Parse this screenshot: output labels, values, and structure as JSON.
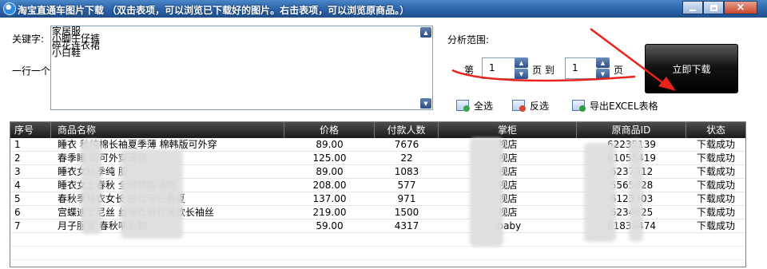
{
  "window": {
    "title": "淘宝直通车图片下载  （双击表项，可以浏览已下载好的图片。右击表项，可以浏览原商品。）",
    "min_symbol": "",
    "close_symbol": "×"
  },
  "keyword": {
    "label": "关键字:",
    "hint": "一行一个",
    "lines": [
      "家居服",
      "小脚牛仔裤",
      "碎花连衣裙",
      "小白鞋"
    ]
  },
  "range": {
    "label": "分析范围:",
    "prefix": "第",
    "from_value": "1",
    "middle": "页 到",
    "to_value": "1",
    "suffix": "页"
  },
  "download_button": "立即下载",
  "actions": {
    "select_all": "全选",
    "invert": "反选",
    "export": "导出EXCEL表格"
  },
  "table": {
    "headers": [
      "序号",
      "商品名称",
      "价格",
      "付款人数",
      "掌柜",
      "原商品ID",
      "状态"
    ],
    "rows": [
      {
        "no": "1",
        "name": "睡衣    秋纯棉长袖夏季薄    棉韩版可外穿",
        "price": "89.00",
        "buyers": "7676",
        "shop": "    视店",
        "id": "62235139",
        "status": "下载成功"
      },
      {
        "no": "2",
        "name": "春季睡              尚可外穿薄款",
        "price": "125.00",
        "buyers": "22",
        "shop": "    视店",
        "id": "61058419",
        "status": "下载成功"
      },
      {
        "no": "3",
        "name": "睡衣女秋季纯          服",
        "price": "89.00",
        "buyers": "1083",
        "shop": "    视店",
        "id": "6237912",
        "status": "下载成功"
      },
      {
        "no": "4",
        "name": "睡衣女士春秋          全棉韩版薄款",
        "price": "208.00",
        "buyers": "577",
        "shop": "    视店",
        "id": "5565628",
        "status": "下载成功"
      },
      {
        "no": "5",
        "name": "春秋季睡衣女长         宽松孕妇春夏",
        "price": "137.00",
        "buyers": "971",
        "shop": "    视店",
        "id": "6123303",
        "status": "下载成功"
      },
      {
        "no": "6",
        "name": "宫蝶迪士尼丝         丝睡衣春秋薄款长袖丝",
        "price": "219.00",
        "buyers": "1500",
        "shop": "    视店",
        "id": "6234625",
        "status": "下载成功"
      },
      {
        "no": "7",
        "name": "月子服夏       春秋哺乳款",
        "price": "59.00",
        "buyers": "4317",
        "shop": "   ,baby",
        "id": "61839474",
        "status": "下载成功"
      }
    ]
  },
  "colors": {
    "annotation": "#e8231c",
    "titlebar": "#2d63a8",
    "header_bg": "#1a1a1a"
  }
}
